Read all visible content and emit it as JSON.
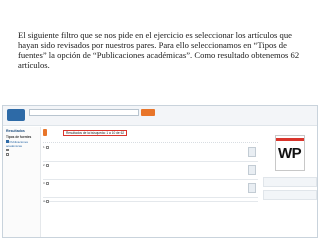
{
  "slide": {
    "text": "El siguiente filtro que se nos pide en el ejercicio es seleccionar los artículos que hayan sido revisados por nuestros pares. Para ello seleccionamos en “Tipos de fuentes” la opción de “Publicaciones académicas”. Como resultado obtenemos 62 artículos."
  },
  "screenshot": {
    "logo_text": "",
    "search_placeholder": "",
    "search_button": "",
    "topbar_links": "",
    "topbar_right": "",
    "left_panel": {
      "heading": "Resultados",
      "items": [
        "",
        "",
        "",
        "",
        "",
        ""
      ],
      "sub_heading": "Tipos de fuentes",
      "source_types": [
        {
          "label": "Publicaciones académicas",
          "checked": true
        },
        {
          "label": "",
          "checked": false
        },
        {
          "label": "",
          "checked": false
        }
      ]
    },
    "results_header": {
      "tab_label": "",
      "count_label": "Resultados de la búsqueda: 1 a 10 de 62",
      "meta": "",
      "sort": ""
    },
    "tools_row": "",
    "results": [
      {
        "num": "1.",
        "title": "",
        "lines": [
          "",
          ""
        ],
        "link": "",
        "badge": ""
      },
      {
        "num": "2.",
        "title": "",
        "lines": [
          "",
          ""
        ],
        "link": "",
        "badge": ""
      },
      {
        "num": "3.",
        "title": "",
        "lines": [
          "",
          ""
        ],
        "link": "",
        "badge": ""
      },
      {
        "num": "4.",
        "title": "",
        "lines": [
          "",
          ""
        ],
        "link": "",
        "badge": ""
      }
    ],
    "right_column": {
      "heading": "",
      "publication_logo": "WP"
    }
  },
  "colors": {
    "accent": "#e8752a",
    "link": "#1a4a86",
    "highlight_border": "#d9342b"
  }
}
